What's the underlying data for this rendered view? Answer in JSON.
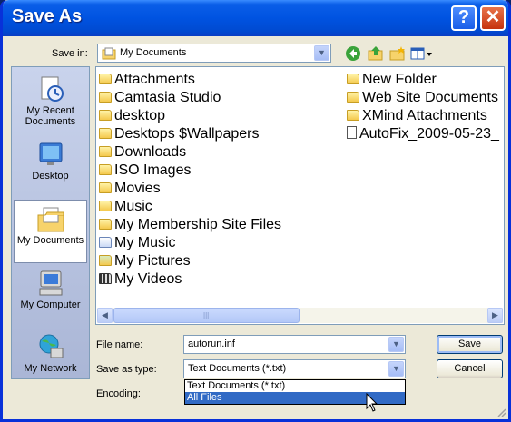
{
  "window": {
    "title": "Save As",
    "help_glyph": "?",
    "close_glyph": "✕"
  },
  "save_in": {
    "label": "Save in:",
    "value": "My Documents",
    "icon": "my-documents-icon"
  },
  "toolbar": {
    "icons": [
      "back-icon",
      "up-folder-icon",
      "new-folder-icon",
      "views-menu-icon"
    ]
  },
  "places": [
    {
      "label": "My Recent Documents",
      "icon": "recent-documents-icon"
    },
    {
      "label": "Desktop",
      "icon": "desktop-icon"
    },
    {
      "label": "My Documents",
      "icon": "my-documents-icon",
      "selected": true
    },
    {
      "label": "My Computer",
      "icon": "my-computer-icon"
    },
    {
      "label": "My Network",
      "icon": "my-network-icon"
    }
  ],
  "files": {
    "column1": [
      {
        "name": "Attachments",
        "icon": "folder-icon"
      },
      {
        "name": "Camtasia Studio",
        "icon": "folder-icon"
      },
      {
        "name": "desktop",
        "icon": "folder-icon"
      },
      {
        "name": "Desktops $Wallpapers",
        "icon": "folder-icon"
      },
      {
        "name": "Downloads",
        "icon": "folder-icon"
      },
      {
        "name": "ISO Images",
        "icon": "folder-icon"
      },
      {
        "name": "Movies",
        "icon": "folder-icon"
      },
      {
        "name": "Music",
        "icon": "folder-icon"
      },
      {
        "name": "My Membership Site Files",
        "icon": "folder-icon"
      },
      {
        "name": "My Music",
        "icon": "music-folder-icon"
      },
      {
        "name": "My Pictures",
        "icon": "pictures-folder-icon"
      },
      {
        "name": "My Videos",
        "icon": "videos-folder-icon"
      }
    ],
    "column2": [
      {
        "name": "New Folder",
        "icon": "folder-icon"
      },
      {
        "name": "Web Site Documents",
        "icon": "folder-icon"
      },
      {
        "name": "XMind Attachments",
        "icon": "folder-icon"
      },
      {
        "name": "AutoFix_2009-05-23_",
        "icon": "text-file-icon"
      }
    ]
  },
  "file_name": {
    "label": "File name:",
    "value": "autorun.inf"
  },
  "save_as_type": {
    "label": "Save as type:",
    "value": "Text Documents (*.txt)",
    "options": [
      "Text Documents (*.txt)",
      "All Files"
    ],
    "highlighted_index": 1
  },
  "encoding": {
    "label": "Encoding:"
  },
  "buttons": {
    "save": "Save",
    "cancel": "Cancel"
  },
  "colors": {
    "title_bar": "#0054e3",
    "highlight": "#316ac5",
    "dialog_bg": "#ece9d8"
  }
}
